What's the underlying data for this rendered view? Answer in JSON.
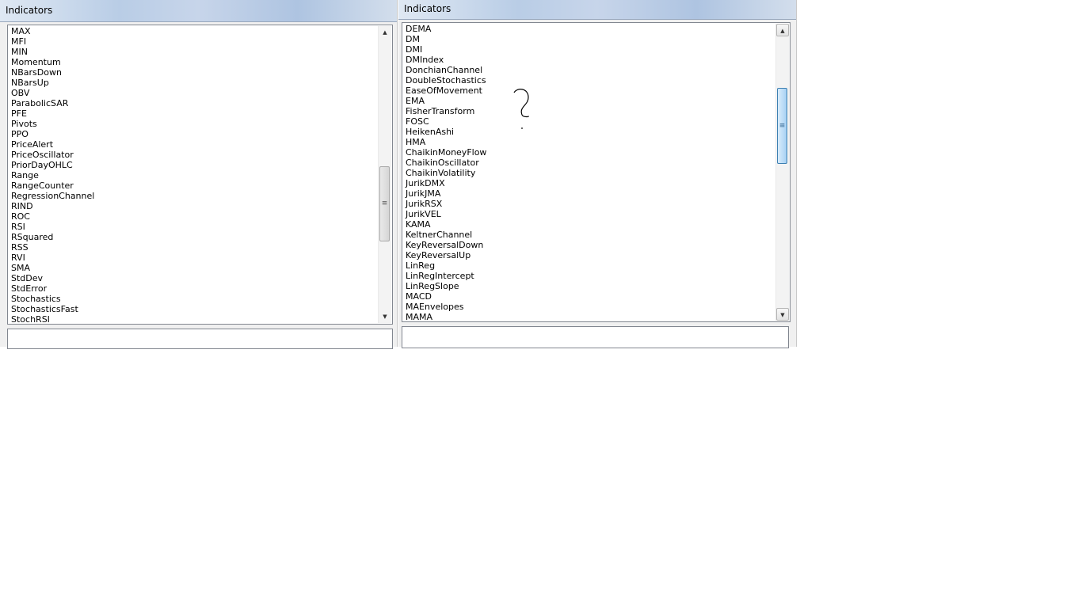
{
  "left_window": {
    "title": "Indicators",
    "items": [
      "MAX",
      "MFI",
      "MIN",
      "Momentum",
      "NBarsDown",
      "NBarsUp",
      "OBV",
      "ParabolicSAR",
      "PFE",
      "Pivots",
      "PPO",
      "PriceAlert",
      "PriceOscillator",
      "PriorDayOHLC",
      "Range",
      "RangeCounter",
      "RegressionChannel",
      "RIND",
      "ROC",
      "RSI",
      "RSquared",
      "RSS",
      "RVI",
      "SMA",
      "StdDev",
      "StdError",
      "Stochastics",
      "StochasticsFast",
      "StochRSI"
    ],
    "description": ""
  },
  "right_window": {
    "title": "Indicators",
    "items": [
      "DEMA",
      "DM",
      "DMI",
      "DMIndex",
      "DonchianChannel",
      "DoubleStochastics",
      "EaseOfMovement",
      "EMA",
      "FisherTransform",
      "FOSC",
      "HeikenAshi",
      "HMA",
      "ChaikinMoneyFlow",
      "ChaikinOscillator",
      "ChaikinVolatility",
      "JurikDMX",
      "JurikJMA",
      "JurikRSX",
      "JurikVEL",
      "KAMA",
      "KeltnerChannel",
      "KeyReversalDown",
      "KeyReversalUp",
      "LinReg",
      "LinRegIntercept",
      "LinRegSlope",
      "MACD",
      "MAEnvelopes",
      "MAMA"
    ],
    "description": "",
    "annotation": "?"
  },
  "icons": {
    "scroll_up": "▲",
    "scroll_down": "▼",
    "grip": "≡"
  }
}
